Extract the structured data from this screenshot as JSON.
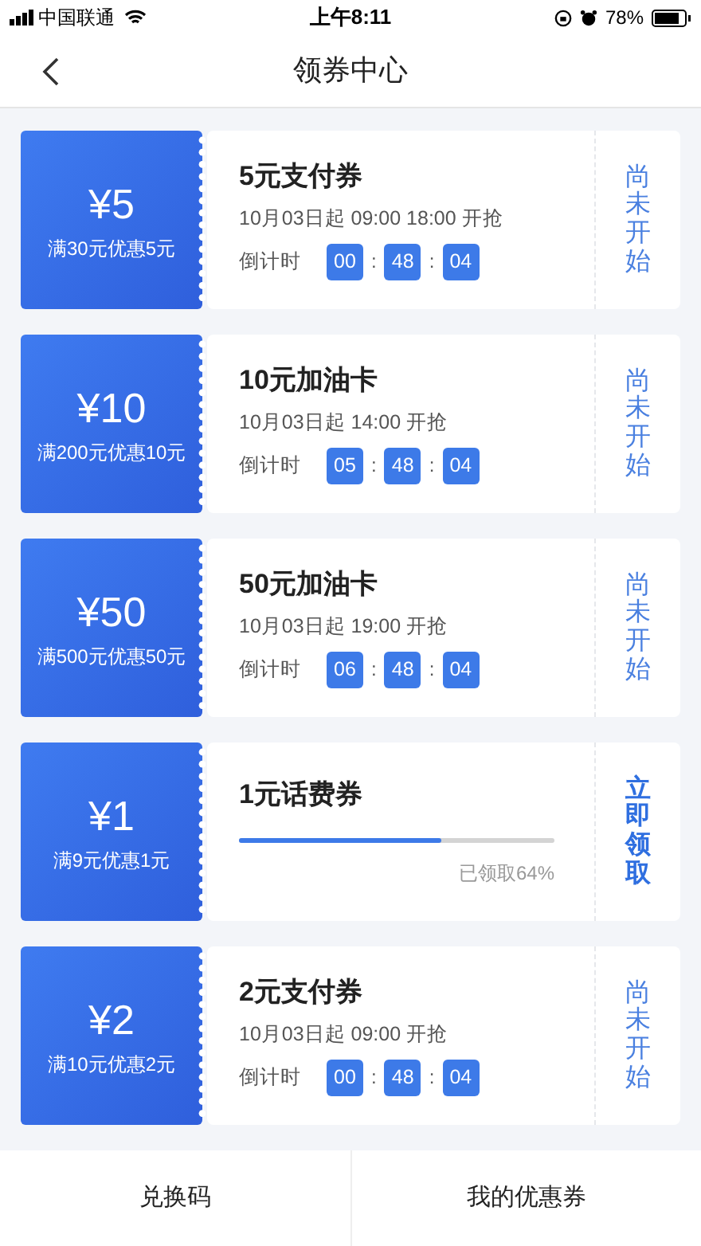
{
  "status_bar": {
    "carrier": "中国联通",
    "time": "上午8:11",
    "battery": "78%"
  },
  "nav": {
    "title": "领券中心"
  },
  "coupons": [
    {
      "kind": "countdown",
      "amount": "¥5",
      "condition": "满30元优惠5元",
      "name": "5元支付券",
      "schedule": "10月03日起 09:00 18:00 开抢",
      "countdown_label": "倒计时",
      "countdown": [
        "00",
        "48",
        "04"
      ],
      "separator": ":",
      "action": "尚未开始",
      "available": false
    },
    {
      "kind": "countdown",
      "amount": "¥10",
      "condition": "满200元优惠10元",
      "name": "10元加油卡",
      "schedule": "10月03日起 14:00 开抢",
      "countdown_label": "倒计时",
      "countdown": [
        "05",
        "48",
        "04"
      ],
      "separator": ":",
      "action": "尚未开始",
      "available": false
    },
    {
      "kind": "countdown",
      "amount": "¥50",
      "condition": "满500元优惠50元",
      "name": "50元加油卡",
      "schedule": "10月03日起 19:00 开抢",
      "countdown_label": "倒计时",
      "countdown": [
        "06",
        "48",
        "04"
      ],
      "separator": ":",
      "action": "尚未开始",
      "available": false
    },
    {
      "kind": "progress",
      "amount": "¥1",
      "condition": "满9元优惠1元",
      "name": "1元话费券",
      "level": 0.64,
      "claimed": "已领取64%",
      "action": "立即领取",
      "available": true
    },
    {
      "kind": "countdown",
      "amount": "¥2",
      "condition": "满10元优惠2元",
      "name": "2元支付券",
      "schedule": "10月03日起 09:00 开抢",
      "countdown_label": "倒计时",
      "countdown": [
        "00",
        "48",
        "04"
      ],
      "separator": ":",
      "action": "尚未开始",
      "available": false
    }
  ],
  "bottom_bar": [
    "兑换码",
    "我的优惠券"
  ]
}
